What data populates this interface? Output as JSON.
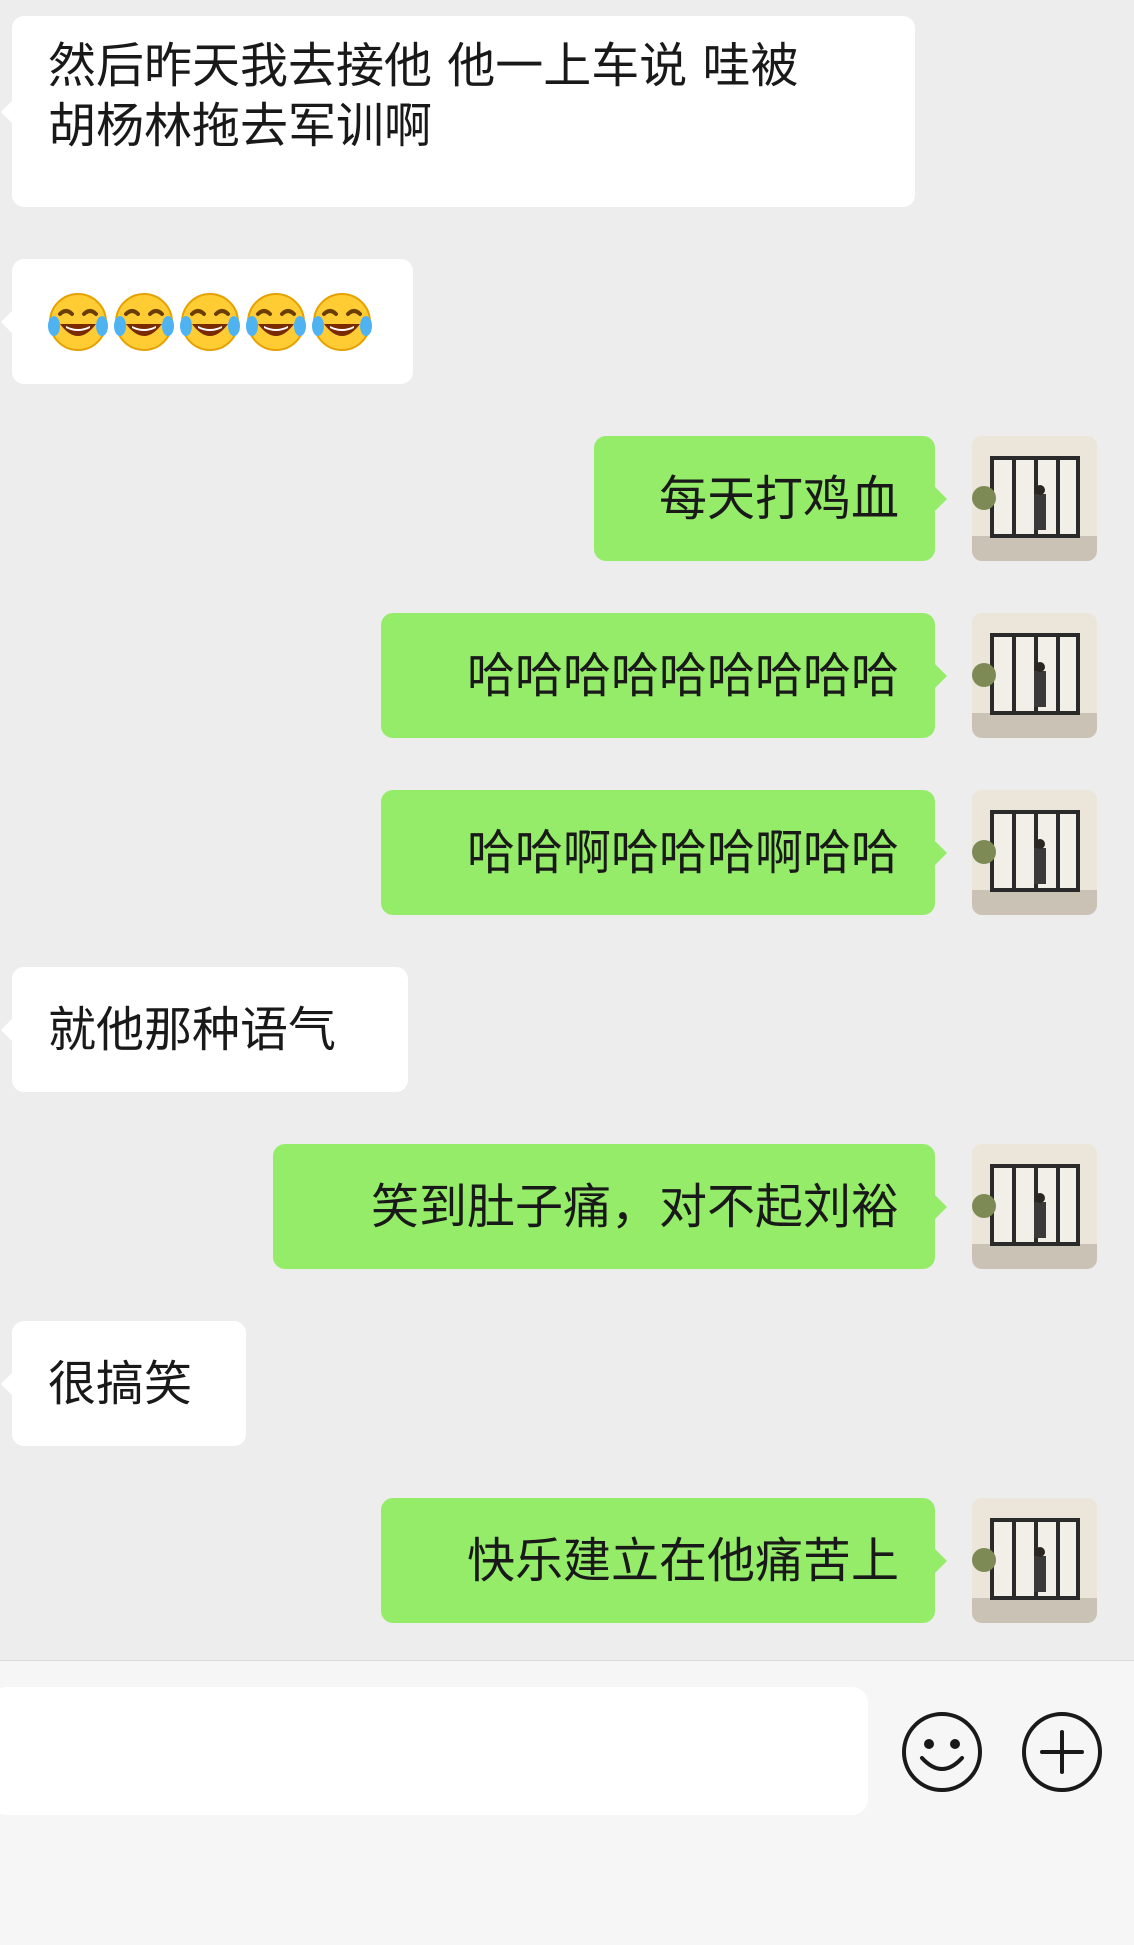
{
  "messages": [
    {
      "from": "other",
      "text": "然后昨天我去接他 他一上车说 哇被\n胡杨林拖去军训啊"
    },
    {
      "from": "other",
      "emoji": "laughing-crying-face",
      "count": 5
    },
    {
      "from": "me",
      "text": "每天打鸡血"
    },
    {
      "from": "me",
      "text": "哈哈哈哈哈哈哈哈哈"
    },
    {
      "from": "me",
      "text": "哈哈啊哈哈哈啊哈哈"
    },
    {
      "from": "other",
      "text": "就他那种语气"
    },
    {
      "from": "me",
      "text": "笑到肚子痛，对不起刘裕"
    },
    {
      "from": "other",
      "text": "很搞笑"
    },
    {
      "from": "me",
      "text": "快乐建立在他痛苦上"
    }
  ],
  "input": {
    "value": "",
    "placeholder": ""
  },
  "icons": {
    "emoji_button": "smiley-face-icon",
    "more_button": "plus-circle-icon"
  },
  "colors": {
    "background": "#ededed",
    "incoming_bubble": "#ffffff",
    "outgoing_bubble": "#95ec69",
    "text": "#191919"
  }
}
